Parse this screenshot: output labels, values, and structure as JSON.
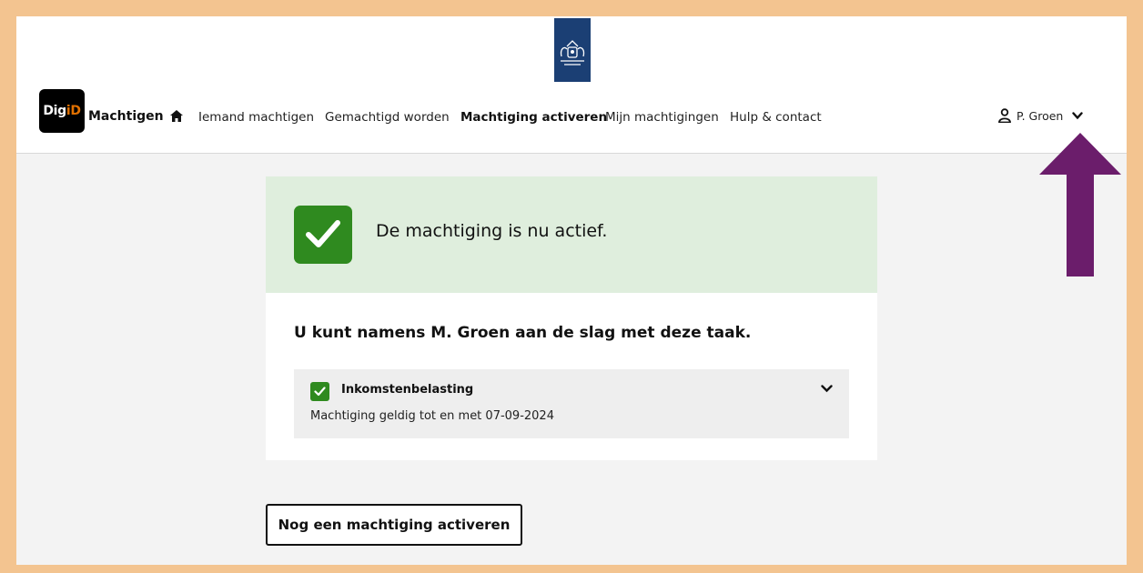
{
  "header": {
    "logo": {
      "text_main": "Dig",
      "text_accent": "iD"
    },
    "brand": "Machtigen",
    "nav": [
      {
        "label": "Iemand machtigen",
        "active": false
      },
      {
        "label": "Gemachtigd worden",
        "active": false
      },
      {
        "label": "Machtiging activeren",
        "active": true
      },
      {
        "label": "Mijn machtigingen",
        "active": false
      },
      {
        "label": "Hulp & contact",
        "active": false
      }
    ],
    "user": {
      "name": "P. Groen"
    }
  },
  "icons": {
    "crest": "royal-coat-of-arms-icon",
    "home": "home-icon",
    "user": "user-icon",
    "chevron": "chevron-down-icon",
    "check": "checkmark-icon",
    "arrow": "arrow-up-annotation"
  },
  "colors": {
    "frame": "#f3c490",
    "crest_blue": "#1b3f74",
    "success_bg": "#dfeedd",
    "success_green": "#2f8a1f",
    "annotation_purple": "#6b1d6b",
    "logo_accent": "#e17000"
  },
  "success": {
    "message": "De machtiging is nu actief."
  },
  "card": {
    "title": "U kunt namens M. Groen aan de slag met deze taak.",
    "task": {
      "name": "Inkomstenbelasting",
      "validity": "Machtiging geldig tot en met 07-09-2024"
    }
  },
  "actions": {
    "another": "Nog een machtiging activeren"
  }
}
